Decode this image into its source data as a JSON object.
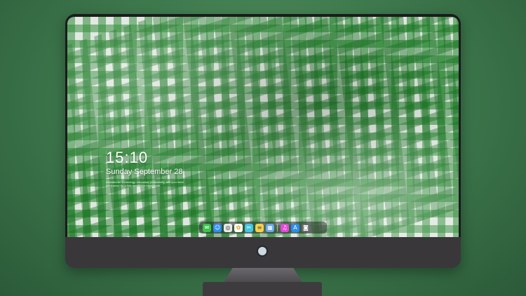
{
  "lockscreen": {
    "time": "15:10",
    "date": "Sunday September 28",
    "note": "Intended for technology, education, productivity, and your ideal companion for a fully immersive experience."
  },
  "dock": {
    "items": [
      {
        "name": "messages-icon",
        "glyph": "✉",
        "color": "#3bc44b"
      },
      {
        "name": "finder-icon",
        "glyph": "☺",
        "color": "#2d8cf0"
      },
      {
        "name": "safari-icon",
        "glyph": "◎",
        "color": "#e9e9e9"
      },
      {
        "name": "photos-icon",
        "glyph": "✿",
        "color": "#ffffff"
      },
      {
        "name": "finalcut-icon",
        "glyph": "✂",
        "color": "#40c6e3"
      },
      {
        "name": "notes-icon",
        "glyph": "≡",
        "color": "#f5d14a"
      },
      {
        "name": "preview-icon",
        "glyph": "▦",
        "color": "#6aa6e8"
      },
      {
        "name": "music-icon",
        "glyph": "♫",
        "color": "#e04ad6"
      },
      {
        "name": "appstore-icon",
        "glyph": "A",
        "color": "#2b8cf4"
      },
      {
        "name": "camera-icon",
        "glyph": "◙",
        "color": "#6b6b6b"
      }
    ]
  }
}
